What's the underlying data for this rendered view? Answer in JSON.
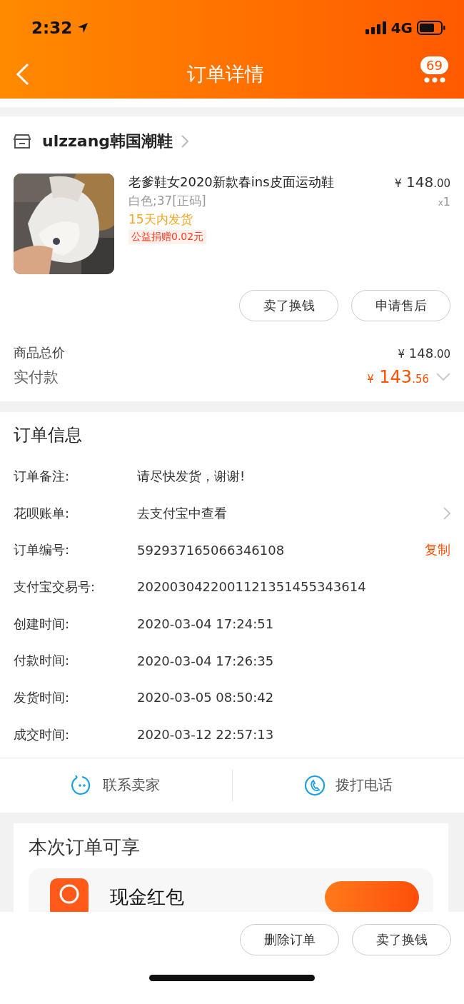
{
  "status_bar": {
    "time": "2:32",
    "network": "4G"
  },
  "nav": {
    "title": "订单详情",
    "badge": "69"
  },
  "shop": {
    "name": "ulzzang韩国潮鞋"
  },
  "item": {
    "title": "老爹鞋女2020新款春ins皮面运动鞋",
    "sku": "白色;37[正码]",
    "shipping": "15天内发货",
    "charity": "公益捐赠0.02元",
    "price_symbol": "¥",
    "price_int": "148",
    "price_dec": ".00",
    "qty_mark": "x",
    "qty": "1"
  },
  "item_buttons": [
    "卖了换钱",
    "申请售后"
  ],
  "totals": [
    {
      "kind": "plain",
      "label": "商品总价",
      "symbol": "¥",
      "int": "148",
      "dec": ".00"
    },
    {
      "kind": "paid",
      "label": "实付款",
      "symbol": "¥",
      "int": "143",
      "dec": ".56"
    }
  ],
  "order_info": {
    "title": "订单信息",
    "rows": [
      {
        "label": "订单备注:",
        "value": "请尽快发货，谢谢!",
        "kind": "plain"
      },
      {
        "label": "花呗账单:",
        "value": "去支付宝中查看",
        "kind": "link"
      },
      {
        "label": "订单编号:",
        "value": "592937165066346108",
        "kind": "copy",
        "action": "复制"
      },
      {
        "label": "支付宝交易号:",
        "value": "2020030422001121351455343614",
        "kind": "plain"
      },
      {
        "label": "创建时间:",
        "value": "2020-03-04 17:24:51",
        "kind": "plain"
      },
      {
        "label": "付款时间:",
        "value": "2020-03-04 17:26:35",
        "kind": "plain"
      },
      {
        "label": "发货时间:",
        "value": "2020-03-05 08:50:42",
        "kind": "plain"
      },
      {
        "label": "成交时间:",
        "value": "2020-03-12 22:57:13",
        "kind": "plain"
      }
    ]
  },
  "contact": [
    {
      "kind": "chat",
      "label": "联系卖家"
    },
    {
      "kind": "phone",
      "label": "拨打电话"
    }
  ],
  "benefits": {
    "title": "本次订单可享",
    "offer": "现金红包"
  },
  "bottom_buttons": [
    "删除订单",
    "卖了换钱"
  ]
}
